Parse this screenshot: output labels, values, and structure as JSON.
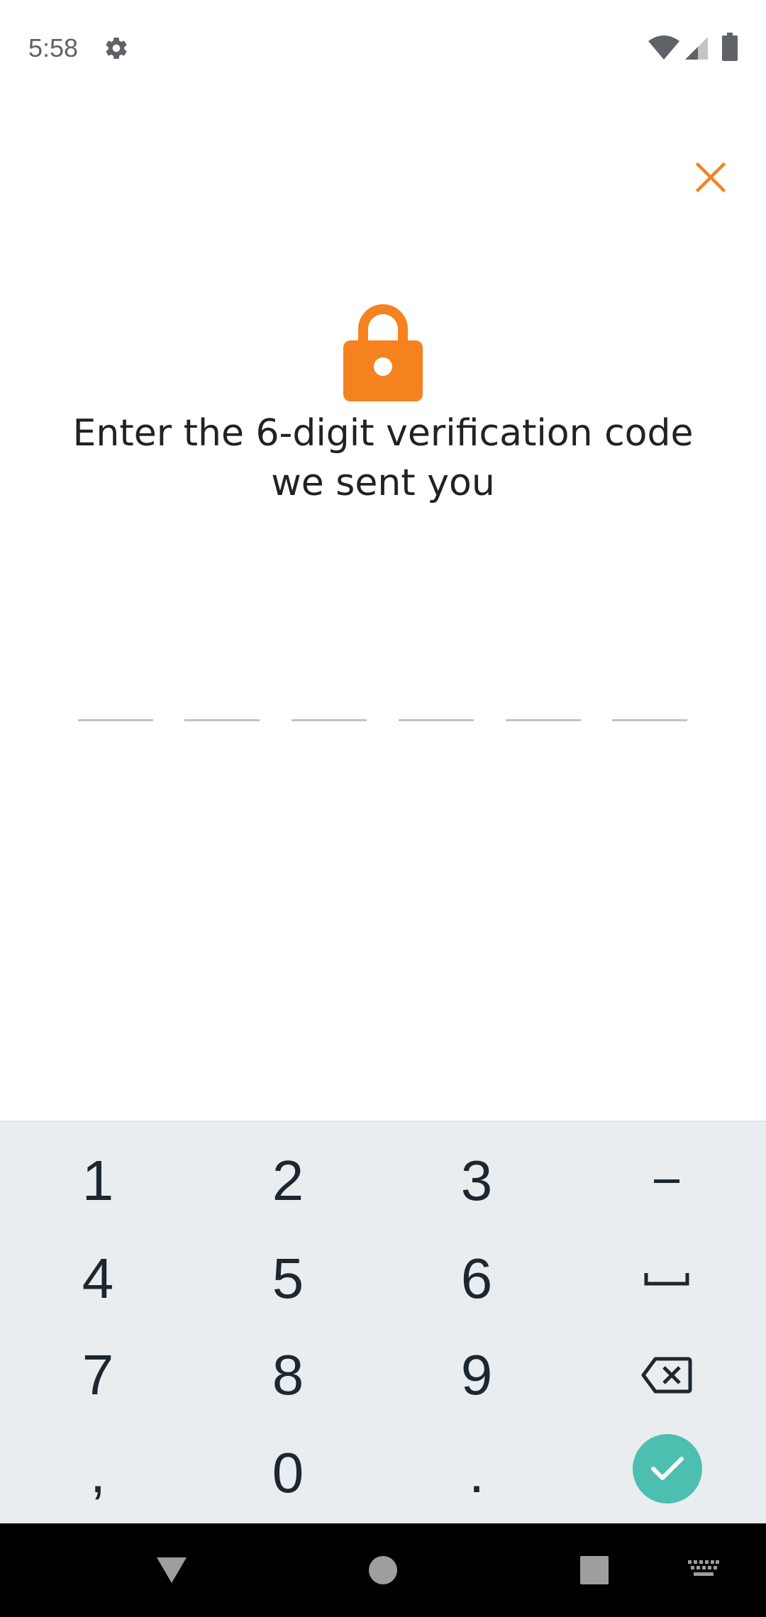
{
  "status_bar": {
    "time": "5:58",
    "icons": [
      "gear-icon",
      "wifi-icon",
      "cell-signal-icon",
      "battery-icon"
    ]
  },
  "header": {
    "close_icon": "close-icon",
    "accent_color": "#f5821f"
  },
  "verification": {
    "lock_icon": "lock-icon",
    "prompt_line1": "Enter the 6-digit verification code",
    "prompt_line2": "we sent you",
    "code_length": 6,
    "code_values": [
      "",
      "",
      "",
      "",
      "",
      ""
    ]
  },
  "keyboard": {
    "rows": [
      [
        "1",
        "2",
        "3",
        "-"
      ],
      [
        "4",
        "5",
        "6",
        "space"
      ],
      [
        "7",
        "8",
        "9",
        "backspace"
      ],
      [
        ",",
        "0",
        ".",
        "enter"
      ]
    ],
    "keys": {
      "k1": "1",
      "k2": "2",
      "k3": "3",
      "dash": "-",
      "k4": "4",
      "k5": "5",
      "k6": "6",
      "k7": "7",
      "k8": "8",
      "k9": "9",
      "comma": ",",
      "k0": "0",
      "period": "."
    },
    "enter_color": "#4dbfb1"
  },
  "nav_bar": {
    "buttons": [
      "back-icon",
      "home-icon",
      "recents-icon",
      "keyboard-switch-icon"
    ]
  }
}
